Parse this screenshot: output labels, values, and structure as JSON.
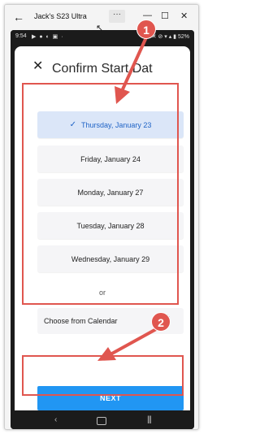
{
  "window": {
    "title": "Jack's S23 Ultra",
    "back_glyph": "←",
    "more_glyph": "···",
    "minimize_glyph": "—",
    "maximize_glyph": "☐",
    "close_glyph": "✕"
  },
  "status_bar": {
    "time": "9:54",
    "left_icons": "▶ ● ◐ ▣ ·",
    "right": "✕ ⊘ ▾ ▴ ▮ 52%"
  },
  "dialog": {
    "close_glyph": "✕",
    "title": "Confirm Start Dat"
  },
  "date_options": [
    {
      "label": "Thursday, January 23",
      "selected": true
    },
    {
      "label": "Friday, January 24",
      "selected": false
    },
    {
      "label": "Monday, January 27",
      "selected": false
    },
    {
      "label": "Tuesday, January 28",
      "selected": false
    },
    {
      "label": "Wednesday, January 29",
      "selected": false
    }
  ],
  "check_glyph": "✓",
  "or_text": "or",
  "calendar_option": {
    "label": "Choose from Calendar",
    "icon": "calendar-icon"
  },
  "next_button": {
    "label": "NEXT"
  },
  "nav_bar": {
    "back_glyph": "‹",
    "recent_glyph": "|||"
  },
  "annotations": {
    "step1": "1",
    "step2": "2",
    "color": "#e0564f"
  },
  "colors": {
    "accent": "#2196f3",
    "selected_bg": "#dbe6f8",
    "selected_text": "#1f63c6"
  }
}
